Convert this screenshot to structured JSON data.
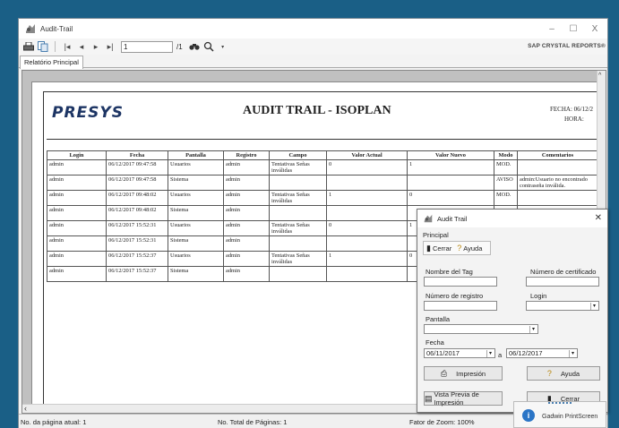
{
  "window": {
    "title": "Audit-Trail",
    "controls": [
      "–",
      "☐",
      "X"
    ]
  },
  "toolbar": {
    "page_number": "1",
    "page_total": "/1",
    "brand": "SAP CRYSTAL REPORTS®"
  },
  "tabs": [
    "Relatório Principal"
  ],
  "report": {
    "logo": "PRESYS",
    "title": "AUDIT TRAIL - ISOPLAN",
    "fecha_label": "FECHA: 06/12/2",
    "hora_label": "HORA:",
    "columns": [
      "Login",
      "Fecha",
      "Pantalla",
      "Registro",
      "Campo",
      "Valor Actual",
      "Valor Nuevo",
      "Modo",
      "Comentarios"
    ],
    "rows": [
      [
        "admin",
        "06/12/2017 09:47:58",
        "Usuarios",
        "admin",
        "Tentativas Señas inválidas",
        "0",
        "1",
        "MOD.",
        ""
      ],
      [
        "admin",
        "06/12/2017 09:47:58",
        "Sistema",
        "admin",
        "",
        "",
        "",
        "AVISO",
        "admin:Usuario no encontrado contraseña inválida."
      ],
      [
        "admin",
        "06/12/2017 09:48:02",
        "Usuarios",
        "admin",
        "Tentativas Señas inválidas",
        "1",
        "0",
        "MOD.",
        ""
      ],
      [
        "admin",
        "06/12/2017 09:48:02",
        "Sistema",
        "admin",
        "",
        "",
        "",
        "",
        ""
      ],
      [
        "admin",
        "06/12/2017 15:52:31",
        "Usuarios",
        "admin",
        "Tentativas Señas inválidas",
        "0",
        "1",
        "",
        ""
      ],
      [
        "admin",
        "06/12/2017 15:52:31",
        "Sistema",
        "admin",
        "",
        "",
        "",
        "",
        ""
      ],
      [
        "admin",
        "06/12/2017 15:52:37",
        "Usuarios",
        "admin",
        "Tentativas Señas inválidas",
        "1",
        "0",
        "",
        ""
      ],
      [
        "admin",
        "06/12/2017 15:52:37",
        "Sistema",
        "admin",
        "",
        "",
        "",
        "",
        ""
      ]
    ]
  },
  "status": {
    "page_current": "No. da página atual: 1",
    "page_total": "No. Total de Páginas: 1",
    "zoom": "Fator de Zoom: 100%"
  },
  "dialog": {
    "title": "Audit Trail",
    "section": "Principal",
    "menu": [
      "Cerrar",
      "Ayuda"
    ],
    "labels": {
      "tag_name": "Nombre del Tag",
      "cert_number": "Número de certificado",
      "record_number": "Número de registro",
      "login": "Login",
      "screen": "Pantalla",
      "date": "Fecha",
      "date_sep": "a"
    },
    "values": {
      "date_from": "06/11/2017",
      "date_to": "06/12/2017"
    },
    "buttons": {
      "print": "Impresión",
      "help": "Ayuda",
      "preview": "Vista Previa de Impresión",
      "close": "Cerrar"
    }
  },
  "toast": {
    "text": "Gadwin PrintScreen"
  }
}
